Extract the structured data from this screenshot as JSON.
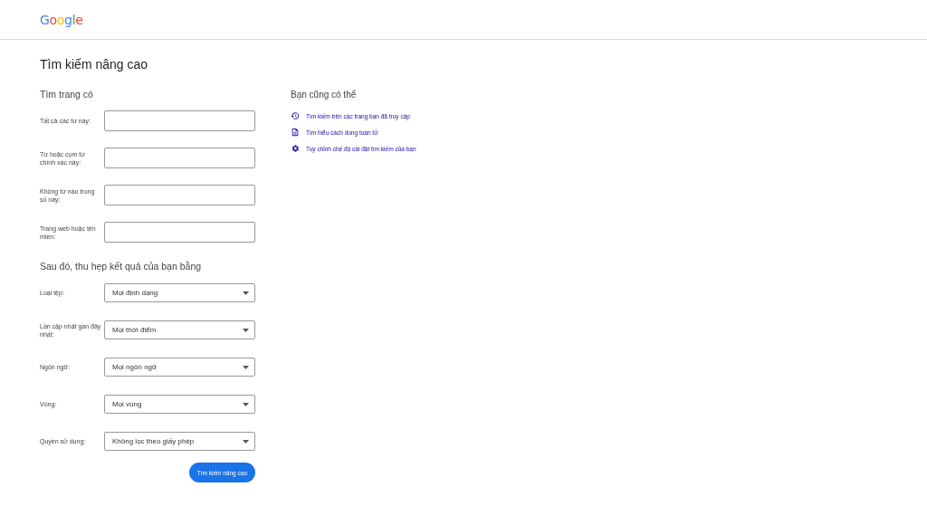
{
  "logo": "Google",
  "title": "Tìm kiếm nâng cao",
  "find_section": {
    "heading": "Tìm trang có",
    "fields": [
      {
        "label": "Tất cả các từ này:"
      },
      {
        "label": "Từ hoặc cụm từ chính xác này:"
      },
      {
        "label": "Không từ nào trong số này:"
      },
      {
        "label": "Trang web hoặc tên miền:"
      }
    ]
  },
  "narrow_section": {
    "heading": "Sau đó, thu hẹp kết quả của bạn bằng",
    "dropdowns": [
      {
        "label": "Loại tệp:",
        "value": "Mọi định dạng"
      },
      {
        "label": "Lần cập nhật gần đây nhất:",
        "value": "Mọi thời điểm"
      },
      {
        "label": "Ngôn ngữ:",
        "value": "Mọi ngôn ngữ"
      },
      {
        "label": "Vùng:",
        "value": "Mọi vùng"
      },
      {
        "label": "Quyền sử dụng:",
        "value": "Không lọc theo giấy phép"
      }
    ]
  },
  "submit_button": "Tìm kiếm nâng cao",
  "also": {
    "heading": "Bạn cũng có thể",
    "links": [
      {
        "kind": "history",
        "text": "Tìm kiếm trên các trang bạn đã truy cập"
      },
      {
        "kind": "document",
        "text": "Tìm hiểu cách dùng toán tử"
      },
      {
        "kind": "gear",
        "text": "Tuỳ chỉnh chế độ cài đặt tìm kiếm của bạn"
      }
    ]
  }
}
